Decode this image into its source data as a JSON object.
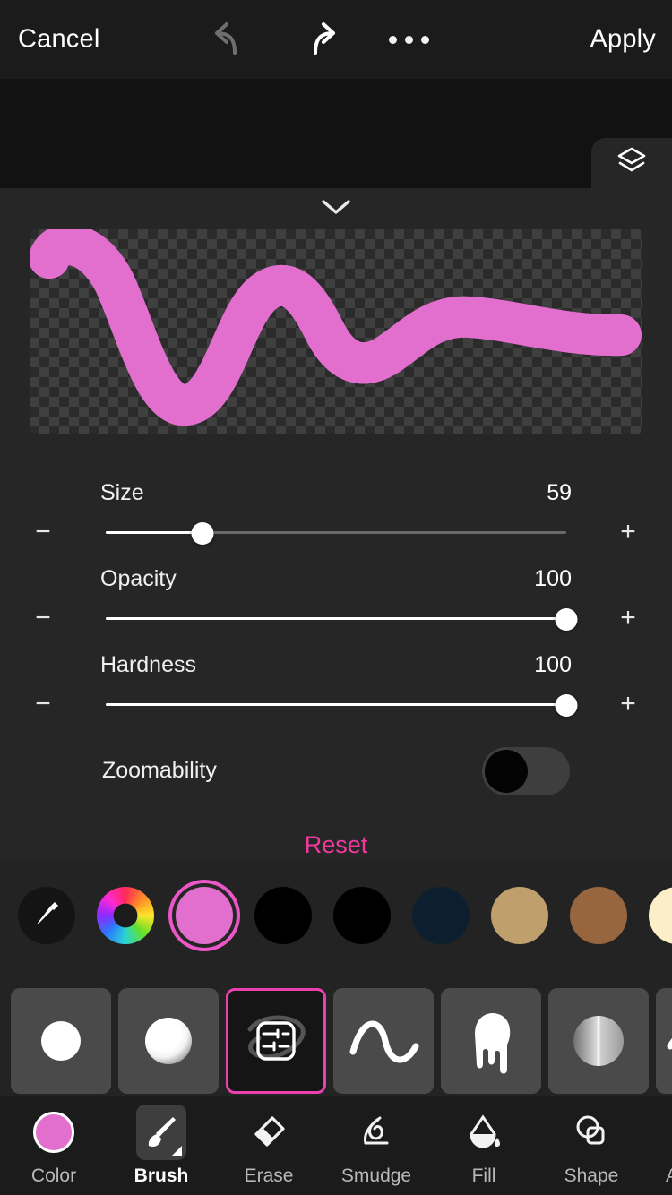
{
  "topbar": {
    "cancel_label": "Cancel",
    "apply_label": "Apply",
    "undo_icon": "undo-arrow-icon",
    "redo_icon": "redo-arrow-icon",
    "more_icon": "more-options-icon"
  },
  "canvas": {
    "layers_icon": "layers-icon"
  },
  "panel": {
    "collapse_icon": "chevron-down-icon",
    "preview": {
      "stroke_outer_color": "#e26ecd",
      "stroke_inner_color": "#ffffff",
      "background": "transparency-checkerboard"
    },
    "sliders": [
      {
        "label": "Size",
        "value": "59",
        "percent": 21,
        "minus": "−",
        "plus": "+"
      },
      {
        "label": "Opacity",
        "value": "100",
        "percent": 100,
        "minus": "−",
        "plus": "+"
      },
      {
        "label": "Hardness",
        "value": "100",
        "percent": 100,
        "minus": "−",
        "plus": "+"
      }
    ],
    "toggle": {
      "label": "Zoomability",
      "state": "off"
    },
    "reset_label": "Reset"
  },
  "colors": {
    "eyedropper_icon": "eyedropper-icon",
    "wheel_icon": "color-wheel-icon",
    "selected_index": 2,
    "swatches": [
      {
        "name": "pink",
        "hex": "#e26ecd",
        "selected": true
      },
      {
        "name": "black",
        "hex": "#000000",
        "selected": false
      },
      {
        "name": "black",
        "hex": "#000000",
        "selected": false
      },
      {
        "name": "navy",
        "hex": "#0d1f2e",
        "selected": false
      },
      {
        "name": "tan",
        "hex": "#bfa06d",
        "selected": false
      },
      {
        "name": "brown",
        "hex": "#97663f",
        "selected": false
      },
      {
        "name": "cream",
        "hex": "#fbeec9",
        "selected": false
      }
    ]
  },
  "brush_presets": [
    {
      "name": "hard-round",
      "icon": "hard-round-brush-icon",
      "active": false
    },
    {
      "name": "soft-round",
      "icon": "soft-round-brush-icon",
      "active": false
    },
    {
      "name": "custom-settings",
      "icon": "brush-settings-icon",
      "active": true
    },
    {
      "name": "wave-stroke",
      "icon": "wave-stroke-brush-icon",
      "active": false
    },
    {
      "name": "drip",
      "icon": "drip-brush-icon",
      "active": false
    },
    {
      "name": "half-gradient",
      "icon": "half-gradient-brush-icon",
      "active": false
    },
    {
      "name": "partial",
      "icon": "partial-brush-icon",
      "active": false
    }
  ],
  "bottom_nav": {
    "items": [
      {
        "label": "Color",
        "icon": "color-circle-icon",
        "active": false
      },
      {
        "label": "Brush",
        "icon": "brush-icon",
        "active": true
      },
      {
        "label": "Erase",
        "icon": "eraser-icon",
        "active": false
      },
      {
        "label": "Smudge",
        "icon": "smudge-icon",
        "active": false
      },
      {
        "label": "Fill",
        "icon": "fill-bucket-icon",
        "active": false
      },
      {
        "label": "Shape",
        "icon": "shape-icon",
        "active": false
      },
      {
        "label": "A",
        "icon": "text-icon",
        "active": false
      }
    ]
  }
}
